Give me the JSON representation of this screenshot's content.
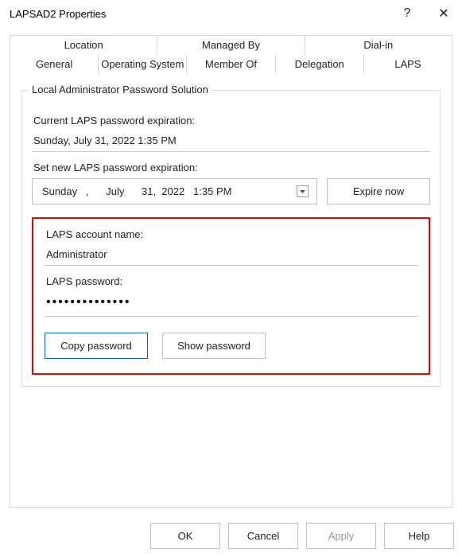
{
  "titlebar": {
    "title": "LAPSAD2 Properties",
    "help_label": "?",
    "close_label": "✕"
  },
  "tabs": {
    "row1": [
      "Location",
      "Managed By",
      "Dial-in"
    ],
    "row2": [
      "General",
      "Operating System",
      "Member Of",
      "Delegation",
      "LAPS"
    ],
    "active": "LAPS"
  },
  "group": {
    "legend": "Local Administrator Password Solution",
    "current_exp_label": "Current LAPS password expiration:",
    "current_exp_value": "Sunday, July 31, 2022 1:35 PM",
    "set_exp_label": "Set new LAPS password expiration:",
    "dtp_text": "Sunday   ,      July      31,  2022   1:35 PM",
    "expire_now_label": "Expire now",
    "account_name_label": "LAPS account name:",
    "account_name_value": "Administrator",
    "password_label": "LAPS password:",
    "password_masked": "••••••••••••••",
    "copy_pw_label": "Copy password",
    "show_pw_label": "Show password"
  },
  "footer": {
    "ok": "OK",
    "cancel": "Cancel",
    "apply": "Apply",
    "help": "Help"
  }
}
